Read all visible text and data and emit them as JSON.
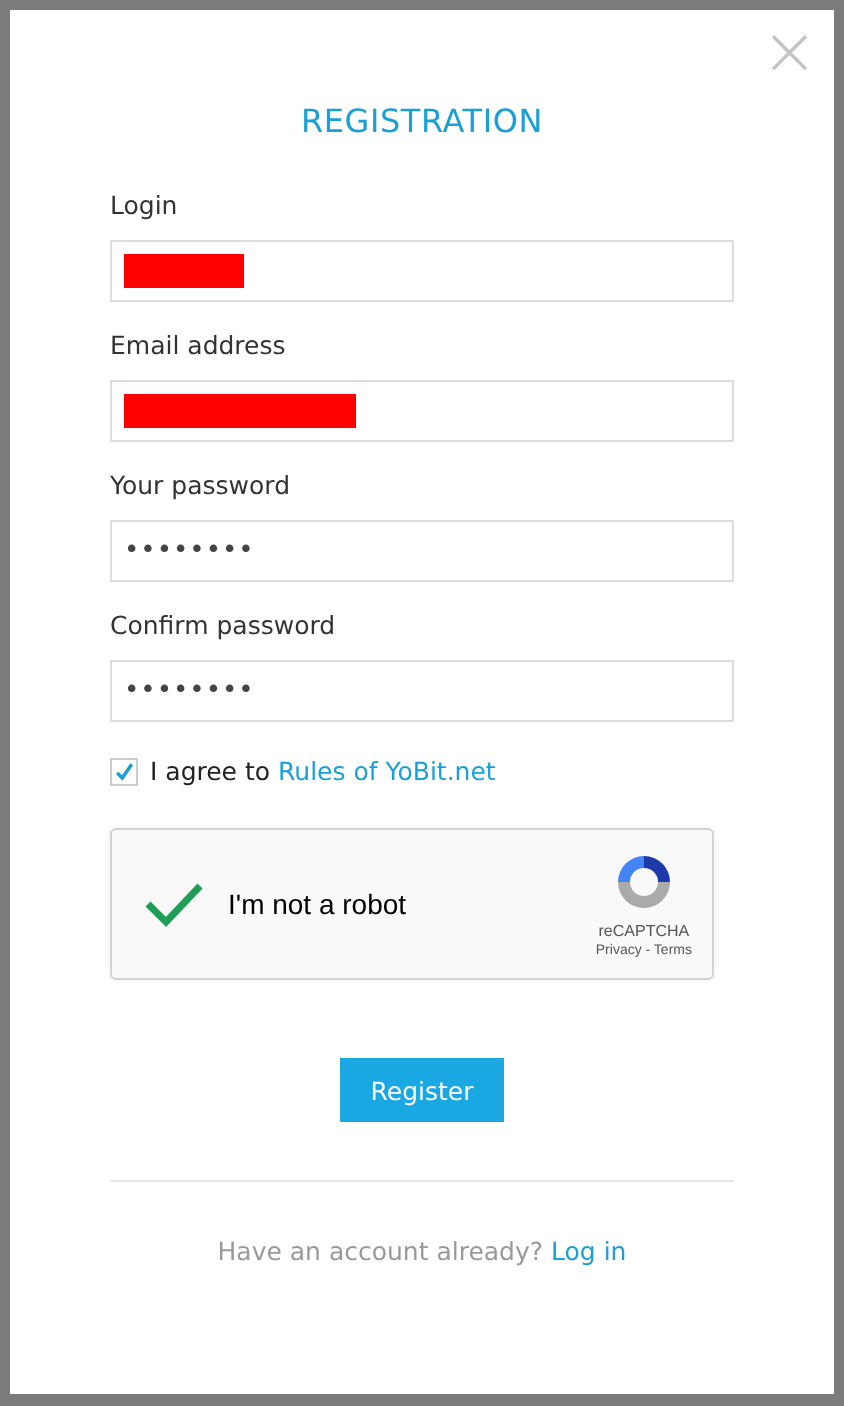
{
  "dialog": {
    "title": "REGISTRATION",
    "close": "×"
  },
  "fields": [
    {
      "label": "Login",
      "kind": "redacted"
    },
    {
      "label": "Email address",
      "kind": "redacted"
    },
    {
      "label": "Your password",
      "kind": "password",
      "value": "••••••••"
    },
    {
      "label": "Confirm password",
      "kind": "password",
      "value": "••••••••"
    }
  ],
  "agree": {
    "checked": true,
    "text": "I agree to",
    "link": "Rules of YoBit.net"
  },
  "captcha": {
    "checked": true,
    "label": "I'm not a robot",
    "brand": "reCAPTCHA",
    "links": "Privacy - Terms"
  },
  "submit": "Register",
  "footer": {
    "text": "Have an account already?",
    "link": "Log in"
  }
}
